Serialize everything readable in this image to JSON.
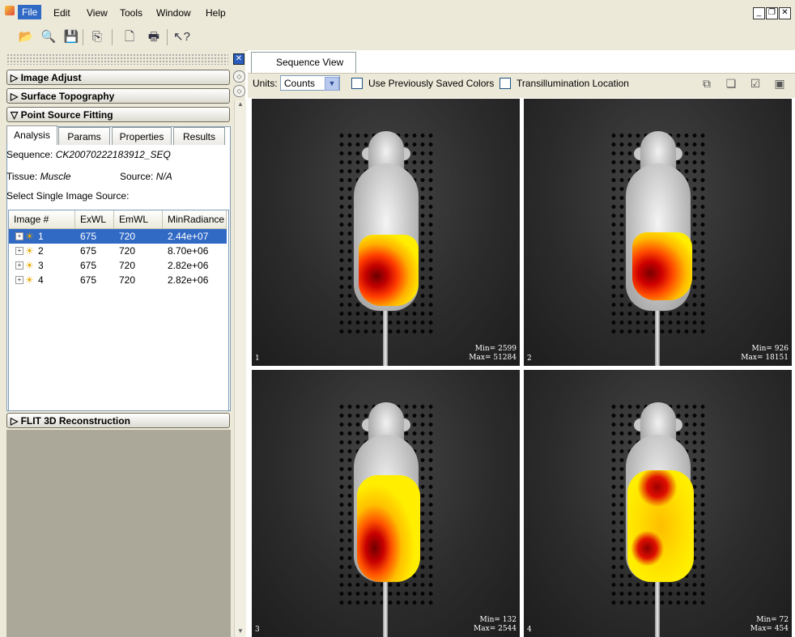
{
  "menu": {
    "items": [
      {
        "label": "File"
      },
      {
        "label": "Edit"
      },
      {
        "label": "View"
      },
      {
        "label": "Tools"
      },
      {
        "label": "Window"
      },
      {
        "label": "Help"
      }
    ]
  },
  "toolbar": {
    "icons": [
      "open-folder-icon",
      "find-icon",
      "save-icon",
      "copy-icon",
      "print-preview-icon",
      "print-icon",
      "help-pointer-icon"
    ]
  },
  "left_panel": {
    "sections": {
      "image_adjust": "Image Adjust",
      "surface_topography": "Surface Topography",
      "point_source_fitting": "Point Source Fitting",
      "flit": "FLIT 3D Reconstruction"
    },
    "tabs": [
      {
        "label": "Analysis"
      },
      {
        "label": "Params"
      },
      {
        "label": "Properties"
      },
      {
        "label": "Results"
      }
    ],
    "sequence_label": "Sequence:",
    "sequence_value": "CK20070222183912_SEQ",
    "tissue_label": "Tissue:",
    "tissue_value": "Muscle",
    "source_label": "Source:",
    "source_value": "N/A",
    "select_label": "Select Single Image Source:",
    "table": {
      "headers": [
        "Image #",
        "ExWL",
        "EmWL",
        "MinRadiance"
      ],
      "rows": [
        {
          "num": "1",
          "exwl": "675",
          "emwl": "720",
          "minrad": "2.44e+07"
        },
        {
          "num": "2",
          "exwl": "675",
          "emwl": "720",
          "minrad": "8.70e+06"
        },
        {
          "num": "3",
          "exwl": "675",
          "emwl": "720",
          "minrad": "2.82e+06"
        },
        {
          "num": "4",
          "exwl": "675",
          "emwl": "720",
          "minrad": "2.82e+06"
        }
      ],
      "selected_row": 0
    }
  },
  "right_panel": {
    "tab_label": "Sequence View",
    "units_label": "Units:",
    "units_value": "Counts",
    "check_saved_colors": "Use Previously Saved Colors",
    "check_transillumination": "Transillumination Location",
    "images": [
      {
        "num": "1",
        "min": "Min= 2599",
        "max": "Max= 51284"
      },
      {
        "num": "2",
        "min": "Min= 926",
        "max": "Max= 18151"
      },
      {
        "num": "3",
        "min": "Min= 132",
        "max": "Max= 2544"
      },
      {
        "num": "4",
        "min": "Min= 72",
        "max": "Max= 454"
      }
    ]
  },
  "colors": {
    "selection": "#316ac5",
    "panel_bg": "#ece9d8"
  }
}
